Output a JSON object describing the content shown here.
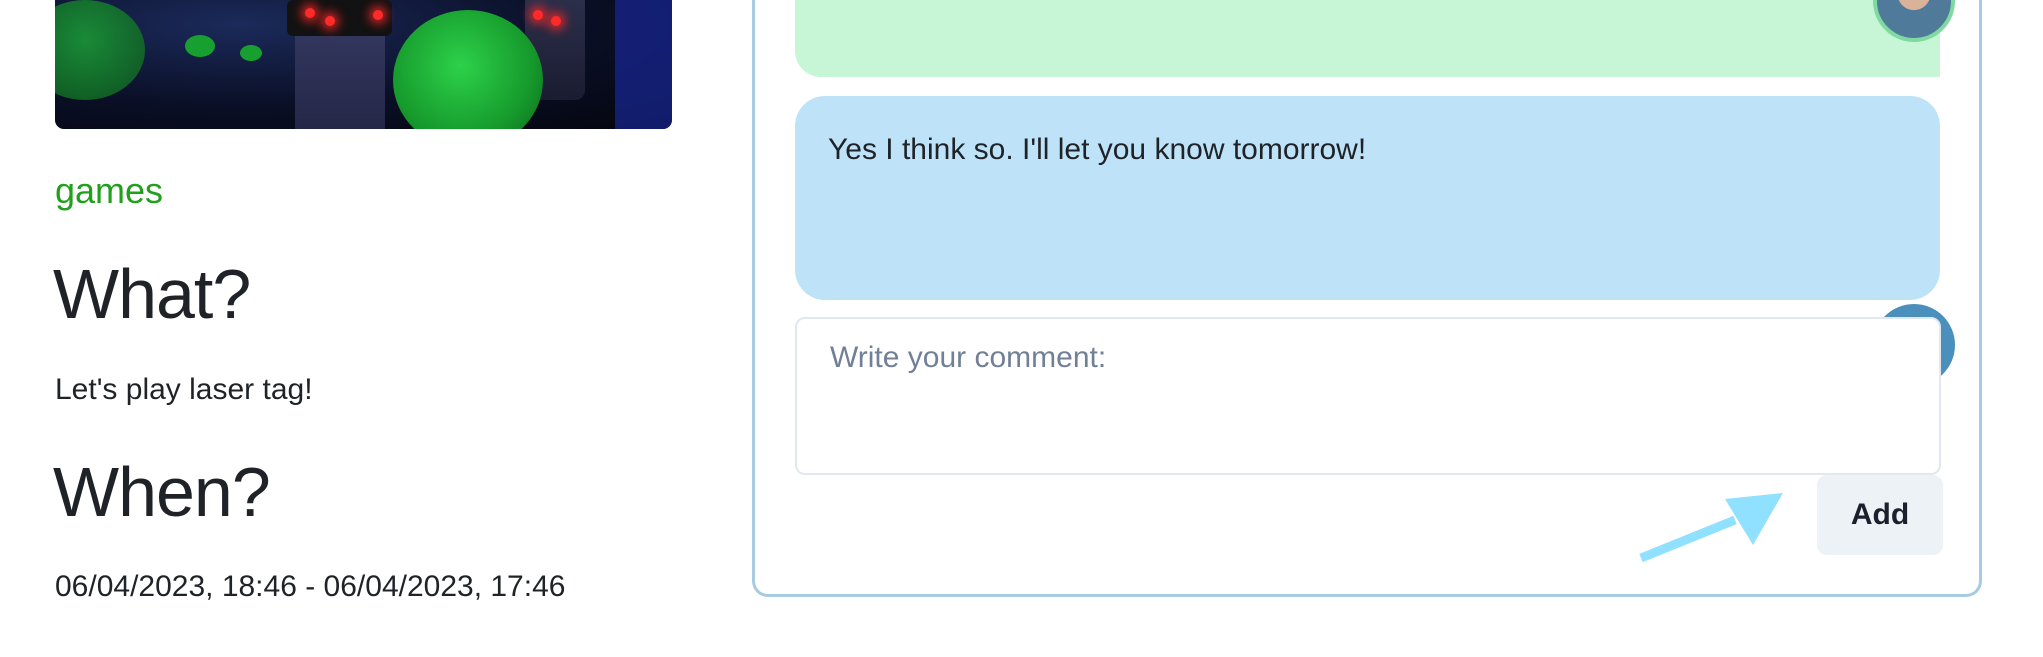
{
  "event": {
    "category": "games",
    "what_heading": "What?",
    "what_text": "Let's play laser tag!",
    "when_heading": "When?",
    "when_text": "06/04/2023, 18:46 - 06/04/2023, 17:46"
  },
  "comments": {
    "items": [
      {
        "text": "",
        "color": "#c6f6d5"
      },
      {
        "text": "Yes I think so. I'll let you know tomorrow!",
        "color": "#bee3f8"
      }
    ],
    "input": {
      "placeholder": "Write your comment:",
      "value": ""
    },
    "add_button": "Add"
  },
  "colors": {
    "accent_green": "#22a01d",
    "frame_border": "#a7cbe3",
    "arrow": "#90e0ff"
  }
}
